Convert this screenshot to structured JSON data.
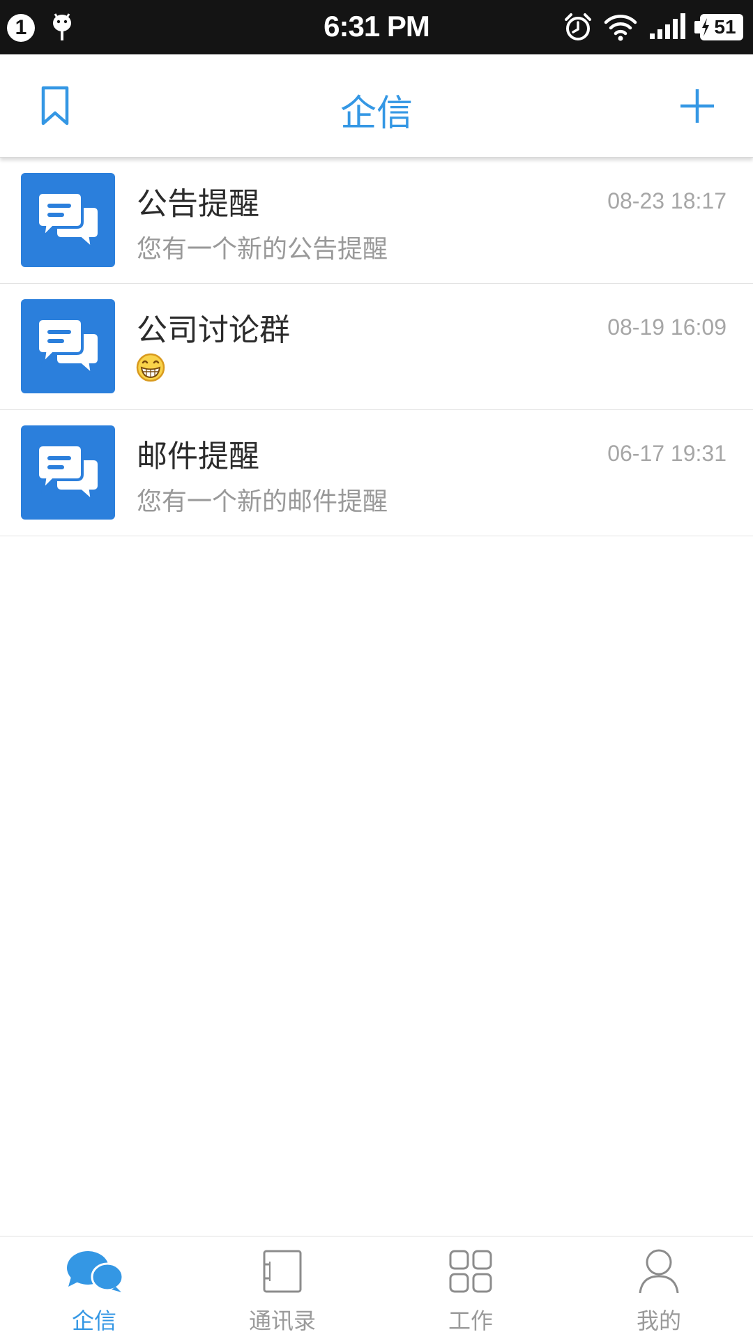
{
  "status_bar": {
    "notification_count": "1",
    "time": "6:31 PM",
    "battery_level": "51"
  },
  "header": {
    "title": "企信",
    "left_icon": "bookmark-icon",
    "right_icon": "plus-icon",
    "accent_color": "#3497e4"
  },
  "conversations": [
    {
      "name": "公告提醒",
      "time": "08-23 18:17",
      "preview": "您有一个新的公告提醒",
      "avatar_icon": "chat-bubbles-icon"
    },
    {
      "name": "公司讨论群",
      "time": "08-19 16:09",
      "preview": "",
      "preview_icon": "grinning-emoji-icon",
      "avatar_icon": "chat-bubbles-icon"
    },
    {
      "name": "邮件提醒",
      "time": "06-17 19:31",
      "preview": "您有一个新的邮件提醒",
      "avatar_icon": "chat-bubbles-icon"
    }
  ],
  "bottom_nav": {
    "items": [
      {
        "label": "企信",
        "icon": "messages-icon",
        "active": true
      },
      {
        "label": "通讯录",
        "icon": "contacts-book-icon",
        "active": false
      },
      {
        "label": "工作",
        "icon": "apps-grid-icon",
        "active": false
      },
      {
        "label": "我的",
        "icon": "profile-icon",
        "active": false
      }
    ]
  },
  "colors": {
    "avatar_bg": "#2b7fdc",
    "status_bar_bg": "#141414",
    "inactive_nav": "#9a9a9a"
  }
}
